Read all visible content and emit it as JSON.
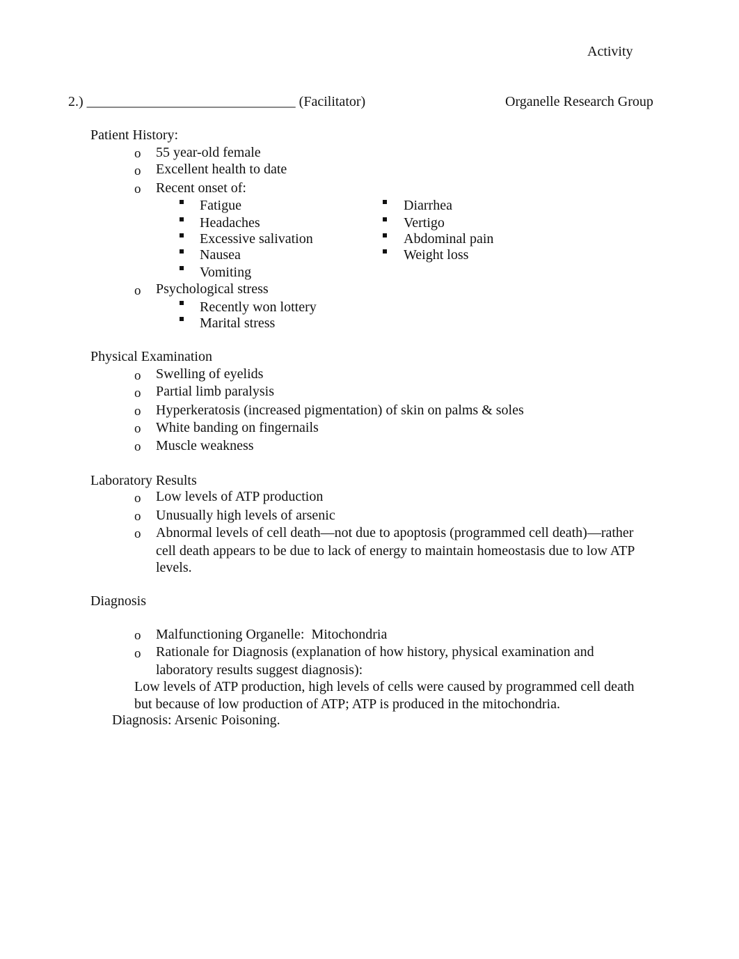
{
  "header": {
    "activity": "Activity",
    "number": "2.)",
    "blank_line": "______________________________",
    "role": "(Facilitator)",
    "group": "Organelle Research Group"
  },
  "patient_history": {
    "title": "Patient History:",
    "items": [
      "55 year-old female",
      "Excellent health to date",
      "Recent onset of:"
    ],
    "symptoms_left": [
      "Fatigue",
      "Headaches",
      "Excessive salivation",
      "Nausea",
      "Vomiting"
    ],
    "symptoms_right": [
      "Diarrhea",
      "Vertigo",
      "Abdominal pain",
      "Weight loss"
    ],
    "stress_label": "Psychological stress",
    "stress_items": [
      "Recently won lottery",
      "Marital stress"
    ]
  },
  "physical_exam": {
    "title": "Physical Examination",
    "items": [
      "Swelling of eyelids",
      "Partial limb paralysis",
      "Hyperkeratosis (increased pigmentation) of skin on palms & soles",
      "White banding on fingernails",
      "Muscle weakness"
    ]
  },
  "lab_results": {
    "title": "Laboratory Results",
    "items": [
      "Low levels of ATP production",
      "Unusually high levels of arsenic"
    ],
    "long_item_lines": [
      "Abnormal levels of cell death—not due to apoptosis (programmed cell death)—rather",
      "cell death appears to be due to lack of energy to maintain homeostasis due to low ATP",
      "levels."
    ]
  },
  "diagnosis": {
    "title": "Diagnosis",
    "organelle_label": "Malfunctioning Organelle:",
    "organelle_value": "Mitochondria",
    "rationale_lines": [
      "Rationale for Diagnosis (explanation of how history, physical examination and",
      "laboratory results suggest diagnosis):"
    ],
    "answer_lines": [
      "Low levels of ATP production, high levels of cells were caused by programmed cell death",
      "but because of low production of ATP; ATP is produced in the mitochondria."
    ],
    "final": "Diagnosis: Arsenic Poisoning."
  },
  "bullets": {
    "circle": "o"
  }
}
